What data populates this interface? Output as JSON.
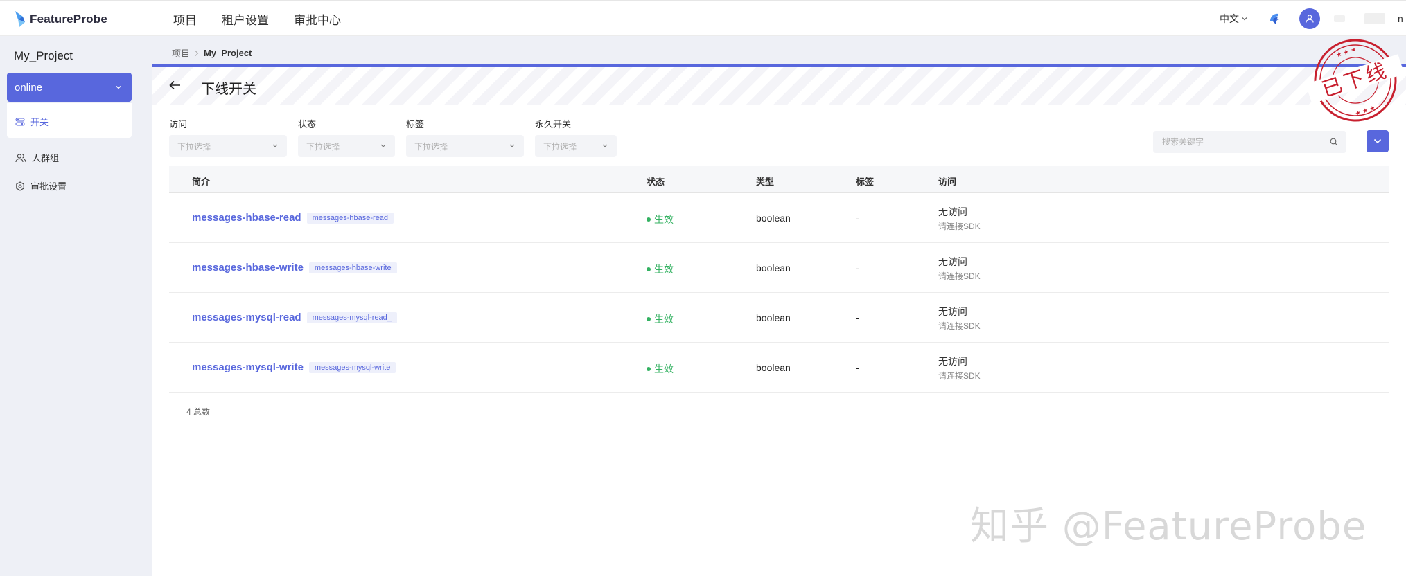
{
  "app": {
    "logo_text": "FeatureProbe"
  },
  "nav": {
    "items": [
      "项目",
      "租户设置",
      "审批中心"
    ]
  },
  "top_right": {
    "language": "中文",
    "user_initial": "n"
  },
  "sidebar": {
    "project_name": "My_Project",
    "environment": "online",
    "env_menu_item": "开关",
    "links": [
      "人群组",
      "审批设置"
    ]
  },
  "breadcrumb": {
    "root": "项目",
    "current": "My_Project"
  },
  "page": {
    "title": "下线开关",
    "stamp_text": "已下线"
  },
  "filters": [
    {
      "label": "访问",
      "placeholder": "下拉选择"
    },
    {
      "label": "状态",
      "placeholder": "下拉选择"
    },
    {
      "label": "标签",
      "placeholder": "下拉选择"
    },
    {
      "label": "永久开关",
      "placeholder": "下拉选择"
    }
  ],
  "search": {
    "placeholder": "搜索关键字"
  },
  "table": {
    "columns": [
      "简介",
      "状态",
      "类型",
      "标签",
      "访问"
    ],
    "rows": [
      {
        "name": "messages-hbase-read",
        "key": "messages-hbase-read",
        "status": "生效",
        "type": "boolean",
        "tags": "-",
        "access": "无访问",
        "access_hint": "请连接SDK"
      },
      {
        "name": "messages-hbase-write",
        "key": "messages-hbase-write",
        "status": "生效",
        "type": "boolean",
        "tags": "-",
        "access": "无访问",
        "access_hint": "请连接SDK"
      },
      {
        "name": "messages-mysql-read",
        "key": "messages-mysql-read_",
        "status": "生效",
        "type": "boolean",
        "tags": "-",
        "access": "无访问",
        "access_hint": "请连接SDK"
      },
      {
        "name": "messages-mysql-write",
        "key": "messages-mysql-write",
        "status": "生效",
        "type": "boolean",
        "tags": "-",
        "access": "无访问",
        "access_hint": "请连接SDK"
      }
    ],
    "total": "4 总数"
  },
  "watermark": "知乎 @FeatureProbe",
  "colors": {
    "primary": "#5867dd",
    "success": "#34b262",
    "stamp": "#c8202f"
  }
}
